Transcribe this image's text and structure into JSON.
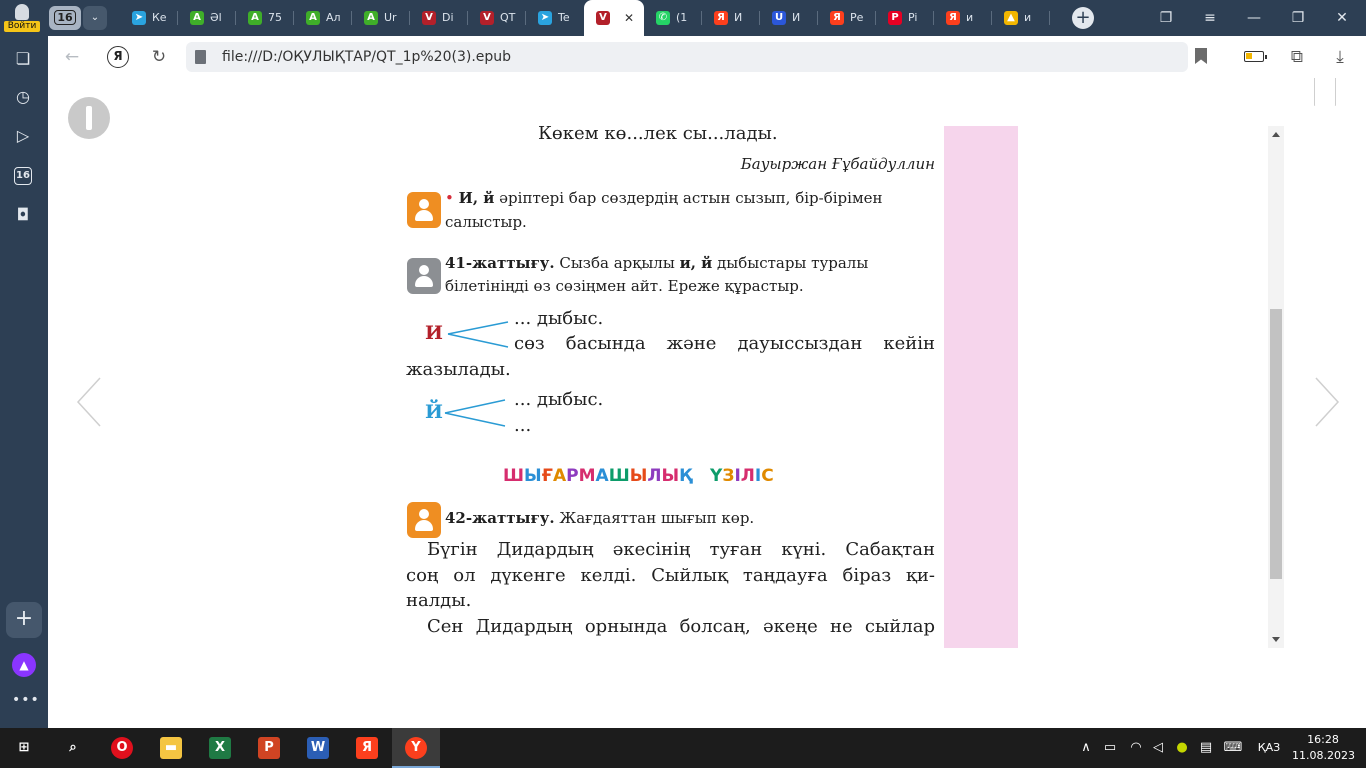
{
  "browser": {
    "login_label": "Войти",
    "tab_count": "16",
    "tabs": [
      {
        "icon": "telegram-icon",
        "label": "Ке",
        "color": "#2aa3df"
      },
      {
        "icon": "green-a-icon",
        "label": "Әl",
        "color": "#3fae29"
      },
      {
        "icon": "green-a-icon",
        "label": "75",
        "color": "#3fae29"
      },
      {
        "icon": "green-a-icon",
        "label": "Ал",
        "color": "#3fae29"
      },
      {
        "icon": "green-a-icon",
        "label": "Ur",
        "color": "#3fae29"
      },
      {
        "icon": "red-book-icon",
        "label": "Di",
        "color": "#b3202a"
      },
      {
        "icon": "red-book-icon",
        "label": "QT",
        "color": "#b3202a"
      },
      {
        "icon": "telegram-icon",
        "label": "Te",
        "color": "#2aa3df"
      },
      {
        "icon": "red-book-icon",
        "label": "",
        "color": "#b3202a",
        "active": true
      },
      {
        "icon": "whatsapp-icon",
        "label": "(1",
        "color": "#25d366"
      },
      {
        "icon": "yandex-icon",
        "label": "И",
        "color": "#fc3f1d"
      },
      {
        "icon": "blue-u-icon",
        "label": "И",
        "color": "#2b57d9"
      },
      {
        "icon": "yandex-icon",
        "label": "Ре",
        "color": "#fc3f1d"
      },
      {
        "icon": "pinterest-icon",
        "label": "Pi",
        "color": "#e60023"
      },
      {
        "icon": "yandex-icon",
        "label": "и",
        "color": "#fc3f1d"
      },
      {
        "icon": "image-icon",
        "label": "и",
        "color": "#f2b600"
      }
    ],
    "url": "file:///D:/ОҚУЛЫҚТАР/QT_1р%20(3).epub",
    "rail": {
      "badge": "16",
      "more": "•••"
    }
  },
  "book": {
    "poem_line": "Көкем кө...лек сы...лады.",
    "author": "Бауыржан Ғұбайдуллин",
    "task1_bullet": "•",
    "task1_bold": "И, й",
    "task1_text": "әріптері бар сөздердің астын сызып, бір-бірімен",
    "task1_text2": "салыстыр.",
    "ex41_num": "41-жаттығу.",
    "ex41_text": "Сызба арқылы",
    "ex41_bold": "и, й",
    "ex41_text_b": "дыбыстары туралы",
    "ex41_text2": "білетініңді өз сөзіңмен айт. Ереже құрастыр.",
    "letter_i": "И",
    "i_line1": "... дыбыс.",
    "i_line2": "сөз басында және дауыссыздан кейін",
    "i_line3": "жазылады.",
    "letter_y": "Й",
    "y_line1": "... дыбыс.",
    "y_line2": "...",
    "banner_letters": [
      "Ш",
      "Ы",
      "Ғ",
      "А",
      "Р",
      "М",
      "А",
      "Ш",
      "Ы",
      "Л",
      "Ы",
      "Қ",
      " ",
      "Ү",
      "З",
      "І",
      "Л",
      "І",
      "С"
    ],
    "banner_colors": [
      "#d62d6e",
      "#2b8fd6",
      "#e64a19",
      "#e08a00",
      "#8e3bbf",
      "#d62d6e",
      "#2b8fd6",
      "#0d9c6a",
      "#e64a19",
      "#8e3bbf",
      "#d62d6e",
      "#2b8fd6",
      "#000000",
      "#0d9c6a",
      "#e08a00",
      "#8e3bbf",
      "#d62d6e",
      "#2b8fd6",
      "#e08a00"
    ],
    "ex42_num": "42-жаттығу.",
    "ex42_text": "Жағдаяттан шығып көр.",
    "p1_line1": "Бүгін Дидардың әкесінің туған күні. Сабақтан",
    "p1_line2": "соң ол дүкенге келді. Сыйлық таңдауға біраз қи-",
    "p1_line3": "налды.",
    "p2_line1": "Сен Дидардың орнында болсаң, әкеңе не сыйлар"
  },
  "taskbar": {
    "apps": [
      {
        "name": "start",
        "glyph": "⊞",
        "color": "#1c1c1c"
      },
      {
        "name": "search",
        "glyph": "⌕",
        "color": "#1c1c1c"
      },
      {
        "name": "opera",
        "glyph": "O",
        "color": "#e0101d"
      },
      {
        "name": "explorer",
        "glyph": "▬",
        "color": "#f4c542"
      },
      {
        "name": "excel",
        "glyph": "X",
        "color": "#1f7a44"
      },
      {
        "name": "powerpoint",
        "glyph": "P",
        "color": "#d04423"
      },
      {
        "name": "word",
        "glyph": "W",
        "color": "#2b5eb5"
      },
      {
        "name": "yandex",
        "glyph": "Я",
        "color": "#fc3f1d"
      },
      {
        "name": "yandex-browser",
        "glyph": "Y",
        "color": "#fc3f1d"
      }
    ],
    "language": "ҚАЗ",
    "time": "16:28",
    "date": "11.08.2023"
  }
}
